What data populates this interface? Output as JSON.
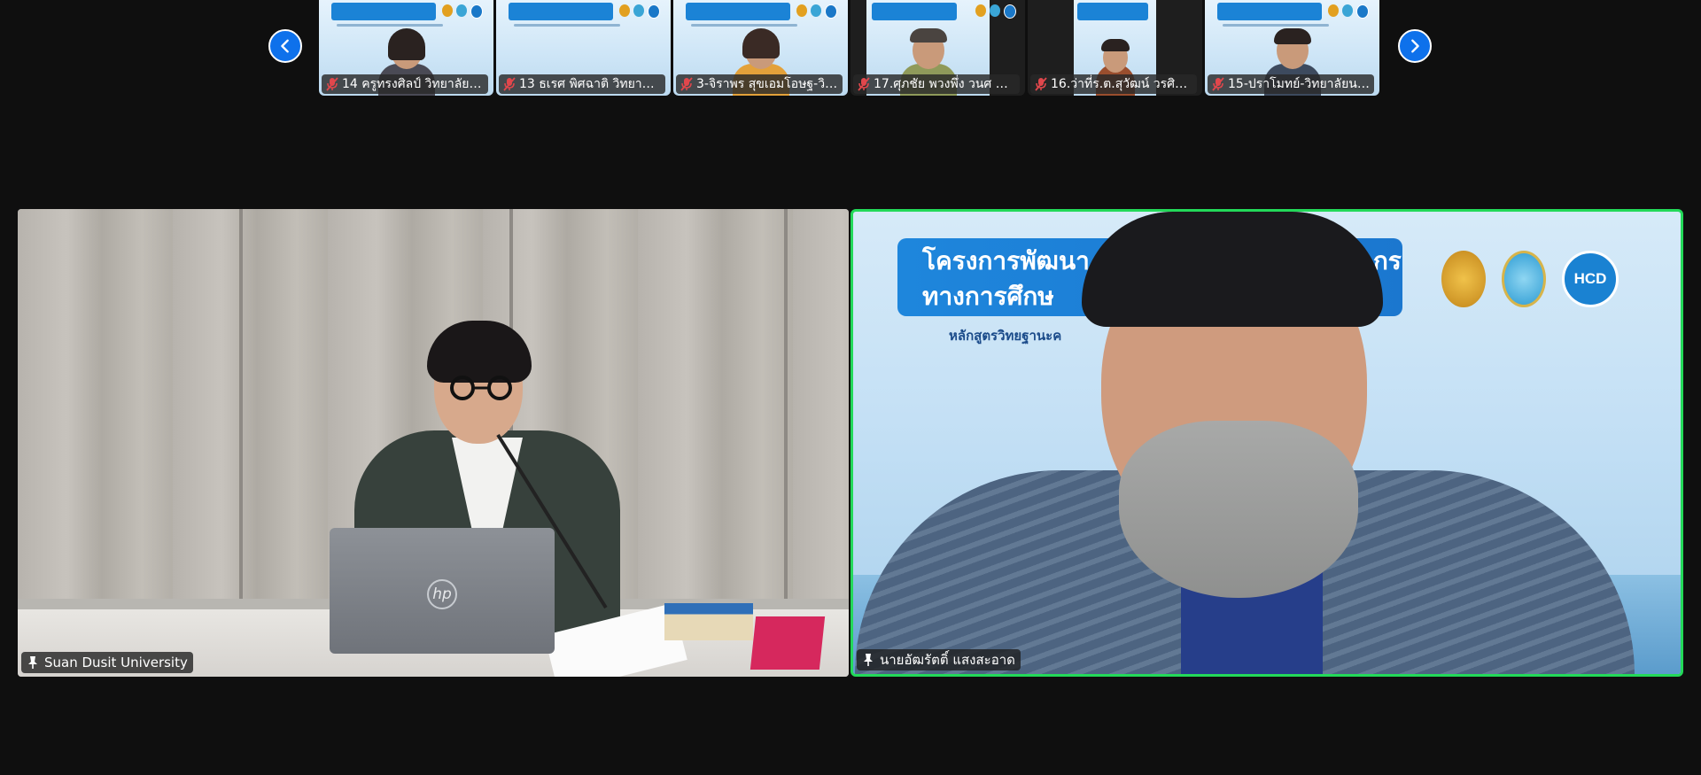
{
  "gallery": {
    "prev_icon": "chevron-left-icon",
    "next_icon": "chevron-right-icon",
    "participants": [
      {
        "name": "14 ครูทรงศิลป์ วิทยาลัยนา...",
        "mic": "muted"
      },
      {
        "name": "13 ธเรศ พิศฉาติ วิทยาลัย...",
        "mic": "muted"
      },
      {
        "name": "3-จิราพร สุขเอมโอษฐ-วิทย...",
        "mic": "muted"
      },
      {
        "name": "17.ศุภชัย พวงพึ่ง วนศ ศา...",
        "mic": "muted"
      },
      {
        "name": "16.ว่าที่ร.ต.สุวัฒน์ วรศิริน...",
        "mic": "muted"
      },
      {
        "name": "15-ปราโมทย์-วิทยาลัยนา...",
        "mic": "muted"
      }
    ]
  },
  "speaker_view": {
    "left": {
      "name": "Suan Dusit University",
      "pinned": true
    },
    "right": {
      "name": "นายอัฒรัตติ์ แสงสะอาด",
      "pinned": true,
      "active_speaker": true,
      "slide": {
        "title_line1": "โครงการพัฒนา",
        "title_line1_end": "กร",
        "title_line2": "ทางการศึกษ",
        "subtitle": "หลักสูตรวิทยฐานะค",
        "logo_text": "HCD"
      }
    }
  },
  "colors": {
    "background": "#0f0f0f",
    "accent_blue": "#0e71eb",
    "active_speaker_border": "#23d959",
    "mute_red": "#e0474c"
  }
}
